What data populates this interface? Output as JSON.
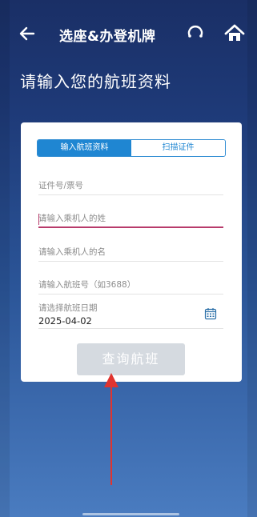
{
  "header": {
    "title": "选座&办登机牌",
    "back_icon": "back-arrow-icon",
    "service_icon": "customer-service-icon",
    "home_icon": "home-icon"
  },
  "heading": "请输入您的航班资料",
  "tabs": [
    {
      "label": "输入航班资料",
      "active": true
    },
    {
      "label": "扫描证件",
      "active": false
    }
  ],
  "form": {
    "id_placeholder": "证件号/票号",
    "surname_placeholder": "请输入乘机人的姓",
    "given_name_placeholder": "请输入乘机人的名",
    "flight_placeholder": "请输入航班号（如3688）",
    "date_label": "请选择航班日期",
    "date_value": "2025-04-02"
  },
  "query_button": "查询航班",
  "colors": {
    "accent": "#1f86d2",
    "focus": "#b83b6b",
    "arrow": "#e0342f",
    "button_disabled": "#d5dae0"
  }
}
